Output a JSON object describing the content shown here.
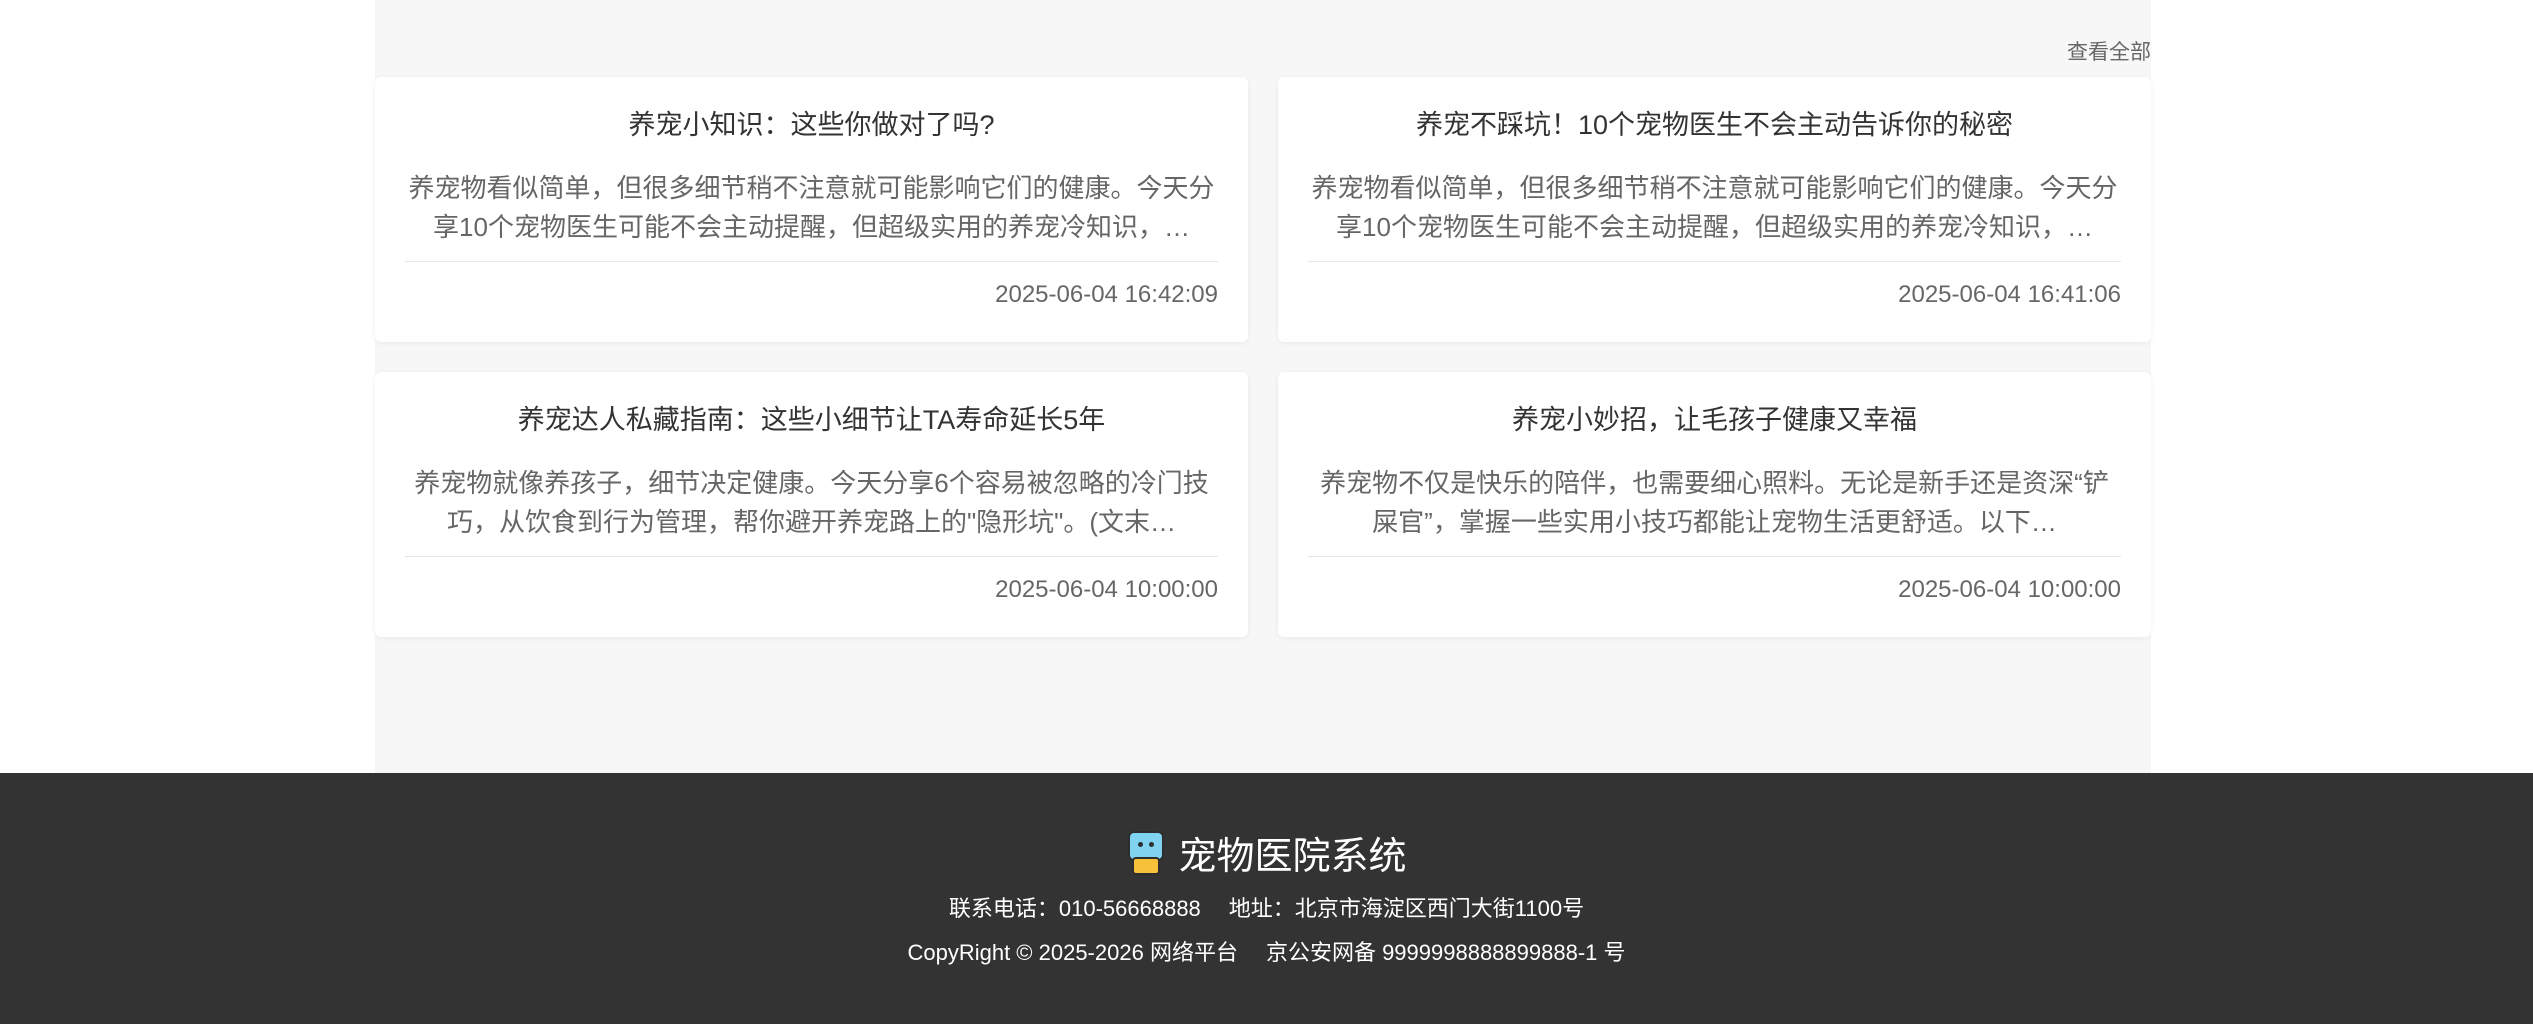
{
  "section": {
    "view_all": "查看全部"
  },
  "articles": [
    {
      "title": "养宠小知识：这些你做对了吗?",
      "summary": "养宠物看似简单，但很多细节稍不注意就可能影响它们的健康。今天分享10个宠物医生可能不会主动提醒，但超级实用的养宠冷知识，…",
      "time": "2025-06-04 16:42:09"
    },
    {
      "title": "养宠不踩坑！10个宠物医生不会主动告诉你的秘密",
      "summary": "养宠物看似简单，但很多细节稍不注意就可能影响它们的健康。今天分享10个宠物医生可能不会主动提醒，但超级实用的养宠冷知识，…",
      "time": "2025-06-04 16:41:06"
    },
    {
      "title": "养宠达人私藏指南：这些小细节让TA寿命延长5年",
      "summary": "养宠物就像养孩子，细节决定健康。今天分享6个容易被忽略的冷门技巧，从饮食到行为管理，帮你避开养宠路上的\"隐形坑\"。(文末…",
      "time": "2025-06-04 10:00:00"
    },
    {
      "title": "养宠小妙招，让毛孩子健康又幸福",
      "summary": "养宠物不仅是快乐的陪伴，也需要细心照料。无论是新手还是资深“铲屎官”，掌握一些实用小技巧都能让宠物生活更舒适。以下…",
      "time": "2025-06-04 10:00:00"
    }
  ],
  "footer": {
    "logo_icon": "pet-robot-icon",
    "title": "宠物医院系统",
    "phone": "联系电话：010-56668888",
    "address": "地址：北京市海淀区西门大街1100号",
    "copyright": "CopyRight © 2025-2026 网络平台",
    "icp": "京公安网备 9999998888899888-1 号"
  }
}
